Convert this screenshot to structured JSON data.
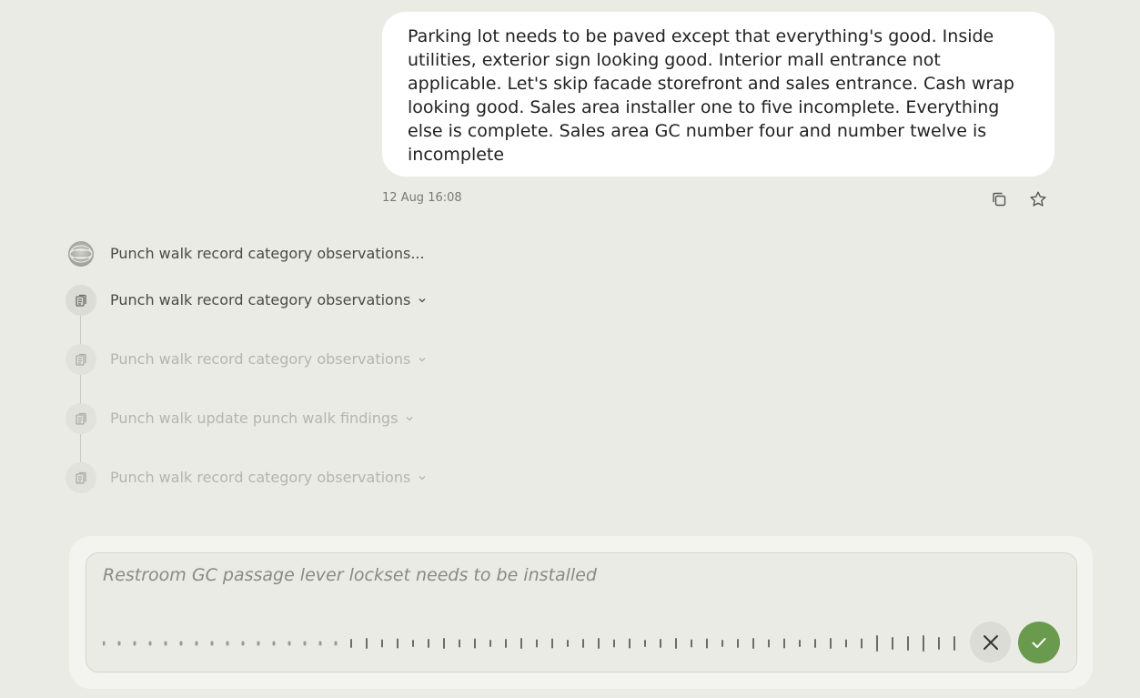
{
  "message": {
    "text": "Parking lot needs to be paved except that everything's good. Inside utilities, exterior sign looking good. Interior mall entrance not applicable. Let's skip facade storefront and sales entrance. Cash wrap looking good. Sales area installer one to five incomplete. Everything else is complete. Sales area GC number four and number twelve is incomplete",
    "timestamp": "12 Aug 16:08",
    "actions": [
      {
        "name": "copy-icon"
      },
      {
        "name": "star-icon"
      }
    ]
  },
  "steps": [
    {
      "label": "Punch walk record category observations...",
      "state": "running",
      "icon": "globe-spinner-icon",
      "expandable": false
    },
    {
      "label": "Punch walk record category observations",
      "state": "active",
      "icon": "clipboard-icon",
      "expandable": true
    },
    {
      "label": "Punch walk record category observations",
      "state": "faded",
      "icon": "clipboard-icon",
      "expandable": true
    },
    {
      "label": "Punch walk update punch walk findings",
      "state": "faded",
      "icon": "clipboard-icon",
      "expandable": true
    },
    {
      "label": "Punch walk record category observations",
      "state": "faded",
      "icon": "clipboard-icon",
      "expandable": true
    }
  ],
  "composer": {
    "transcript": "Restroom GC passage lever lockset needs to be installed",
    "cancel_icon": "close-icon",
    "confirm_icon": "checkmark-icon",
    "confirm_color": "#6a9a4e"
  }
}
